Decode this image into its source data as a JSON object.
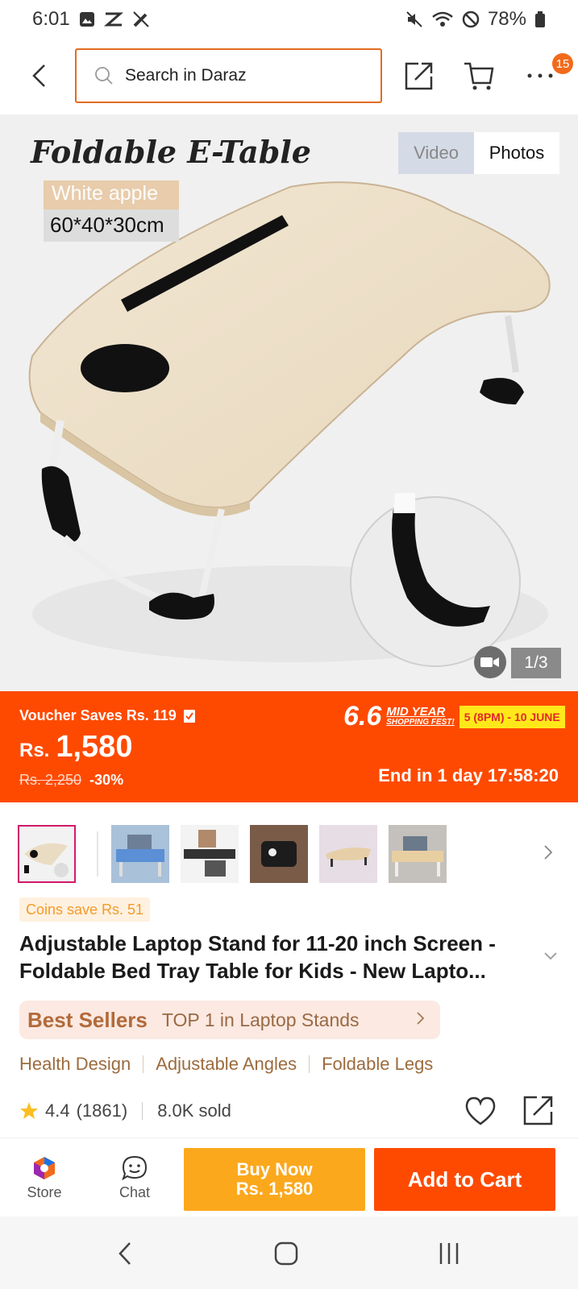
{
  "status_bar": {
    "time": "6:01",
    "battery": "78%",
    "left_icons": [
      "gallery-icon",
      "sync-icon",
      "edit-off-icon"
    ],
    "right_icons": [
      "mute-icon",
      "wifi-icon",
      "dnd-icon",
      "battery-icon"
    ]
  },
  "header": {
    "search_placeholder": "Search in Daraz",
    "cart_badge": "15"
  },
  "hero": {
    "overlay_title": "Foldable E-Table",
    "color_tag": "White apple",
    "size_tag": "60*40*30cm",
    "tabs": {
      "video": "Video",
      "photos": "Photos"
    },
    "counter": "1/3"
  },
  "price": {
    "voucher_text": "Voucher Saves Rs. 119",
    "currency": "Rs.",
    "amount": "1,580",
    "original": "Rs. 2,250",
    "discount": "-30%",
    "campaign_big": "6.6",
    "campaign_line1": "MID YEAR",
    "campaign_line2": "SHOPPING FEST!",
    "campaign_dates": "5 (8PM) - 10 JUNE",
    "countdown": "End in 1 day 17:58:20",
    "colors": {
      "banner": "#fe4a00",
      "dates_bg": "#ffe81a"
    }
  },
  "thumbnails": [
    "thumb-1",
    "thumb-2",
    "thumb-3",
    "thumb-4",
    "thumb-5",
    "thumb-6"
  ],
  "product": {
    "coins_text": "Coins save Rs. 51",
    "title": "Adjustable Laptop Stand for 11-20 inch Screen - Foldable Bed Tray Table for Kids - New Lapto...",
    "best_sellers_label": "Best Sellers",
    "best_sellers_rank": "TOP 1 in Laptop Stands",
    "features": [
      "Health Design",
      "Adjustable Angles",
      "Foldable Legs"
    ],
    "rating": "4.4",
    "reviews": "(1861)",
    "sold": "8.0K sold"
  },
  "bottom_bar": {
    "store_label": "Store",
    "chat_label": "Chat",
    "buy_now_label": "Buy Now",
    "buy_now_price": "Rs. 1,580",
    "add_to_cart_label": "Add to Cart"
  }
}
